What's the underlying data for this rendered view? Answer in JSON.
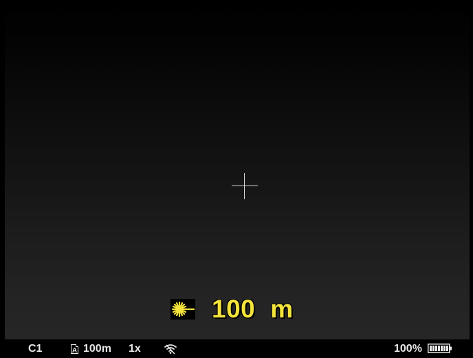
{
  "range_readout": {
    "laser_icon": "laser-beam-icon",
    "value": "100",
    "unit": "m",
    "color": "#f3e33b"
  },
  "crosshair": {
    "icon": "crosshair-reticle",
    "color": "#d9d9d9"
  },
  "status_bar": {
    "profile": "C1",
    "mode_icon": "A",
    "calibration_distance": "100m",
    "zoom": "1x",
    "wifi_icon": "wifi-icon",
    "battery_percent": "100%",
    "battery_level": 1.0
  }
}
